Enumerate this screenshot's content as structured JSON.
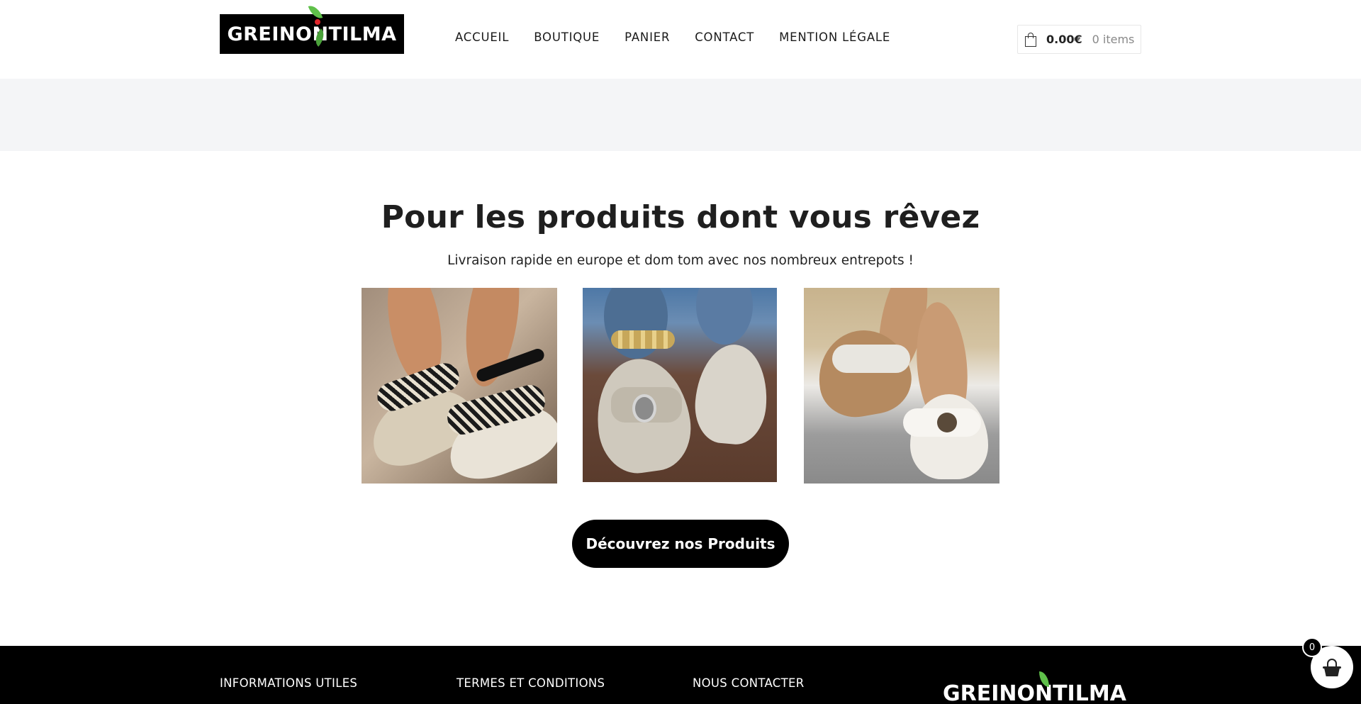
{
  "header": {
    "logo_text": "GREINONTILMA",
    "nav": [
      {
        "label": "ACCUEIL"
      },
      {
        "label": "BOUTIQUE"
      },
      {
        "label": "PANIER"
      },
      {
        "label": "CONTACT"
      },
      {
        "label": "MENTION LÉGALE"
      }
    ],
    "cart": {
      "amount": "0.00€",
      "items": "0 items",
      "icon": "shopping-bag-icon"
    }
  },
  "hero": {
    "title": "Pour les produits dont vous rêvez",
    "subtitle": "Livraison rapide en europe et dom tom avec nos nombreux entrepots !",
    "products": [
      {
        "name": "sandal-zebra-wedge"
      },
      {
        "name": "sandal-silver-chain"
      },
      {
        "name": "sandal-white-buckle"
      }
    ],
    "cta_label": "Découvrez nos Produits"
  },
  "footer": {
    "columns": [
      {
        "title": "INFORMATIONS UTILES"
      },
      {
        "title": "TERMES ET CONDITIONS"
      },
      {
        "title": "NOUS CONTACTER"
      }
    ],
    "logo_text": "GREINONTILMA"
  },
  "floating_cart": {
    "count": "0",
    "icon": "basket-icon"
  },
  "colors": {
    "accent": "#000000",
    "band": "#f4f5f7",
    "leaf": "#5fc04a"
  }
}
